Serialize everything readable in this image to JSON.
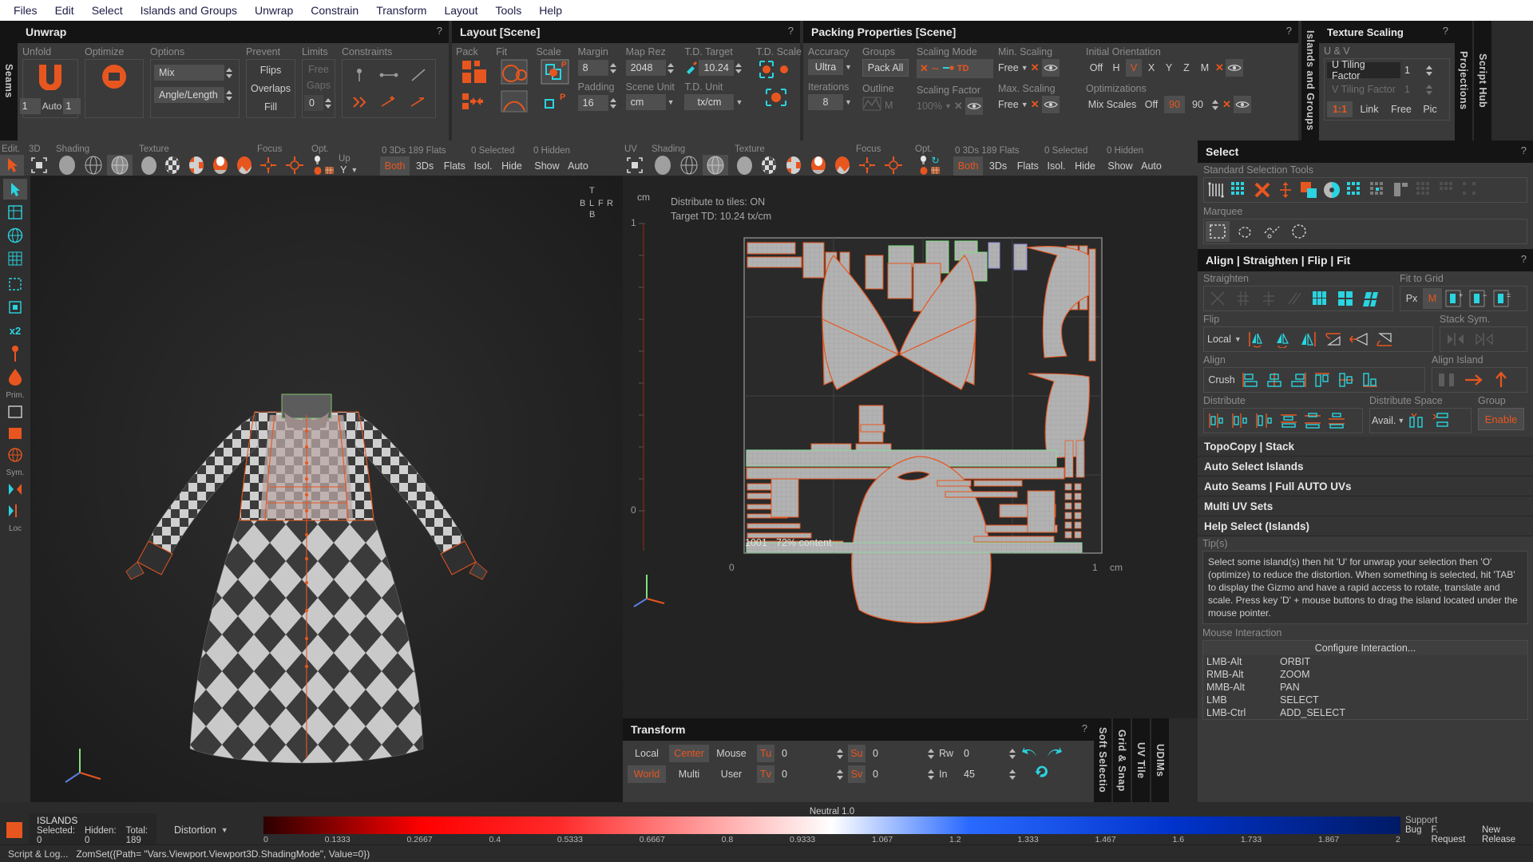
{
  "menubar": {
    "items": [
      "Files",
      "Edit",
      "Select",
      "Islands and Groups",
      "Unwrap",
      "Constrain",
      "Transform",
      "Layout",
      "Tools",
      "Help"
    ]
  },
  "left_vtab": {
    "label": "Seams"
  },
  "right_vtabs": {
    "islands": "Islands and Groups",
    "projections": "Projections",
    "script": "Script Hub"
  },
  "unwrap_panel": {
    "title": "Unwrap",
    "help": "?",
    "groups": {
      "unfold": "Unfold",
      "optimize": "Optimize",
      "options": "Options",
      "prevent": "Prevent",
      "limits": "Limits",
      "constraints": "Constraints"
    },
    "mix_value": "Mix",
    "angle_length": "Angle/Length",
    "unfold_count": "1",
    "auto_label": "Auto",
    "auto_value": "1",
    "prevent": [
      "Flips",
      "Overlaps",
      "Fill"
    ],
    "limits": [
      "Free",
      "Gaps"
    ],
    "limit_value": "0"
  },
  "layout_panel": {
    "title": "Layout [Scene]",
    "help": "?",
    "groups": {
      "pack": "Pack",
      "fit": "Fit",
      "scale": "Scale",
      "margin": "Margin",
      "padding": "Padding",
      "maprez": "Map Rez",
      "sceneunit": "Scene Unit",
      "tdtarget": "T.D. Target",
      "tdunit": "T.D. Unit",
      "tdscale": "T.D. Scale"
    },
    "margin": "8",
    "padding": "16",
    "map_rez": "2048",
    "scene_unit": "cm",
    "td_target": "10.24",
    "td_unit": "tx/cm"
  },
  "packing_panel": {
    "title": "Packing Properties [Scene]",
    "help": "?",
    "groups": {
      "accuracy": "Accuracy",
      "groups": "Groups",
      "scaling_mode": "Scaling Mode",
      "min_scaling": "Min. Scaling",
      "initial_orientation": "Initial Orientation",
      "iterations": "Iterations",
      "outline": "Outline",
      "scaling_factor": "Scaling Factor",
      "max_scaling": "Max. Scaling",
      "optimizations": "Optimizations"
    },
    "accuracy": "Ultra",
    "iterations": "8",
    "pack_all": "Pack All",
    "outline_m": "M",
    "scaling_mode_td": "TD",
    "scaling_factor": "100%",
    "min_scaling": "Free",
    "max_scaling": "Free",
    "orientation_options": [
      "Off",
      "H",
      "V",
      "X",
      "Y",
      "Z",
      "M"
    ],
    "orientation_selected": "V",
    "optimizations_label": "Mix Scales",
    "opt_off": "Off",
    "opt_v1": "90",
    "opt_v2": "90"
  },
  "texture_scaling_panel": {
    "title": "Texture Scaling",
    "help": "?",
    "group_uv": "U & V",
    "u_label": "U Tiling Factor",
    "u_value": "1",
    "v_label": "V Tiling Factor",
    "v_value": "1",
    "modes": [
      "1:1",
      "Link",
      "Free",
      "Pic"
    ],
    "mode_selected": "1:1"
  },
  "viewport3d_bar": {
    "edit_label": "Edit.",
    "groups": {
      "mode": "3D",
      "shading": "Shading",
      "texture": "Texture",
      "focus": "Focus",
      "opt": "Opt.",
      "up": "Up"
    },
    "up_axis": "Y",
    "stats": {
      "counts": "0 3Ds 189 Flats",
      "selected": "0 Selected",
      "hidden": "0 Hidden"
    },
    "filters": [
      "Both",
      "3Ds",
      "Flats"
    ],
    "filter_selected": "Both",
    "vis": [
      "Isol.",
      "Hide",
      "Show",
      "Auto"
    ]
  },
  "viewportuv_bar": {
    "uv_label": "UV",
    "groups": {
      "shading": "Shading",
      "texture": "Texture",
      "focus": "Focus",
      "opt": "Opt."
    },
    "stats": {
      "counts": "0 3Ds 189 Flats",
      "selected": "0 Selected",
      "hidden": "0 Hidden"
    },
    "filters": [
      "Both",
      "3Ds",
      "Flats"
    ],
    "filter_selected": "Both",
    "vis": [
      "Isol.",
      "Hide",
      "Show",
      "Auto"
    ]
  },
  "uv_viewport": {
    "unit": "cm",
    "info_distribute": "Distribute to tiles: ON",
    "info_td": "Target TD: 10.24 tx/cm",
    "axis_top": "1",
    "axis_bottom": "0",
    "axis_x_zero": "0",
    "axis_x_one": "1",
    "axis_x_unit": "cm",
    "tile_id": "1001",
    "tile_content": "72% content"
  },
  "viewport3d": {
    "view_letters": [
      "T",
      "B",
      "L",
      "F",
      "R",
      "B"
    ]
  },
  "select_panel": {
    "title": "Select",
    "help": "?",
    "group_standard": "Standard Selection Tools",
    "group_marquee": "Marquee"
  },
  "align_panel": {
    "title": "Align | Straighten | Flip | Fit",
    "help": "?",
    "groups": {
      "straighten": "Straighten",
      "fit_to_grid": "Fit to Grid",
      "flip": "Flip",
      "stack_sym": "Stack Sym.",
      "align": "Align",
      "align_island": "Align Island",
      "distribute": "Distribute",
      "distribute_space": "Distribute Space",
      "group": "Group"
    },
    "fit_px": "Px",
    "fit_m": "M",
    "flip_space": "Local",
    "crush": "Crush",
    "distribute_space_value": "Avail.",
    "group_enable": "Enable"
  },
  "sections": [
    {
      "label": "TopoCopy | Stack"
    },
    {
      "label": "Auto Select Islands"
    },
    {
      "label": "Auto Seams | Full AUTO UVs"
    },
    {
      "label": "Multi UV Sets"
    },
    {
      "label": "Help Select (Islands)"
    }
  ],
  "tips": {
    "label": "Tip(s)",
    "text": "Select some island(s) then hit 'U' for unwrap your selection then 'O' (optimize) to reduce the distortion. When something is selected, hit 'TAB' to display the Gizmo and have a rapid access to rotate, translate and scale. Press key 'D' + mouse buttons to drag the island located under the mouse pointer."
  },
  "mouse_interaction": {
    "label": "Mouse Interaction",
    "configure": "Configure Interaction...",
    "rows": [
      {
        "key": "LMB-Alt",
        "action": "ORBIT"
      },
      {
        "key": "RMB-Alt",
        "action": "ZOOM"
      },
      {
        "key": "MMB-Alt",
        "action": "PAN"
      },
      {
        "key": "LMB",
        "action": "SELECT"
      },
      {
        "key": "LMB-Ctrl",
        "action": "ADD_SELECT"
      }
    ]
  },
  "transform_panel": {
    "title": "Transform",
    "help": "?",
    "space": [
      "Local",
      "World"
    ],
    "space_selected": "World",
    "pivot": [
      "Center",
      "Multi"
    ],
    "pivot_selected": "Center",
    "target": [
      "Mouse",
      "User"
    ],
    "tu_label": "Tu",
    "tu_value": "0",
    "tv_label": "Tv",
    "tv_value": "0",
    "su_label": "Su",
    "su_value": "0",
    "sv_label": "Sv",
    "sv_value": "0",
    "rw_label": "Rw",
    "rw_value": "0",
    "in_label": "In",
    "in_value": "45"
  },
  "bottom_vtabs": {
    "soft": "Soft Selectio",
    "grid": "Grid & Snap",
    "uvtile": "UV Tile",
    "udims": "UDIMs"
  },
  "statusbar": {
    "islands_title": "ISLANDS",
    "selected_label": "Selected: 0",
    "hidden_label": "Hidden: 0",
    "total_label": "Total: 189",
    "mode": "Distortion",
    "neutral": "Neutral 1.0",
    "ticks": [
      "0",
      "0.1333",
      "0.2667",
      "0.4",
      "0.5333",
      "0.6667",
      "0.8",
      "0.9333",
      "1.067",
      "1.2",
      "1.333",
      "1.467",
      "1.6",
      "1.733",
      "1.867",
      "2"
    ],
    "support_label": "Support",
    "support_links": [
      "Bug",
      "F. Request",
      "New Release"
    ]
  },
  "logbar": {
    "label": "Script & Log...",
    "text": "ZomSet({Path= \"Vars.Viewport.Viewport3D.ShadingMode\", Value=0})"
  },
  "colors": {
    "accent": "#e8561f",
    "cyan": "#2ad4e0",
    "panel": "#3a3a3a",
    "title": "#141414",
    "viewport": "#232323"
  }
}
